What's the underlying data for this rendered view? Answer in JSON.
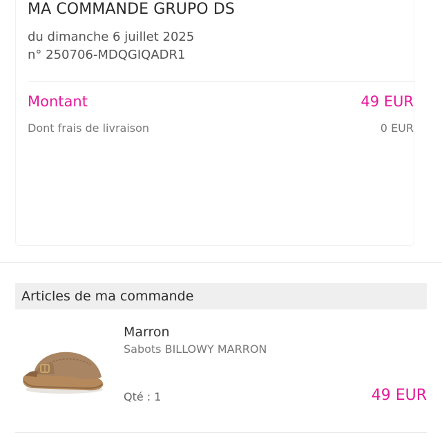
{
  "order": {
    "title": "MA COMMANDE GRUPO DS",
    "date": "du dimanche 6 juillet 2025",
    "number": "n° 250706-MDQGIQADR1"
  },
  "summary": {
    "amount_label": "Montant",
    "amount_value": "49 EUR",
    "shipping_label": "Dont frais de livraison",
    "shipping_value": "0 EUR"
  },
  "articles": {
    "title": "Articles de ma commande",
    "items": [
      {
        "color": "Marron",
        "name": "Sabots BILLOWY MARRON",
        "quantity": "Qté : 1",
        "price": "49 EUR",
        "image_icon": "brown-clog-sandal-image"
      }
    ]
  },
  "colors": {
    "accent": "#e6199b",
    "text_dark": "#2b2b2b",
    "text_muted": "#777777",
    "header_bg": "#efefef",
    "divider": "#e6e6e6"
  }
}
